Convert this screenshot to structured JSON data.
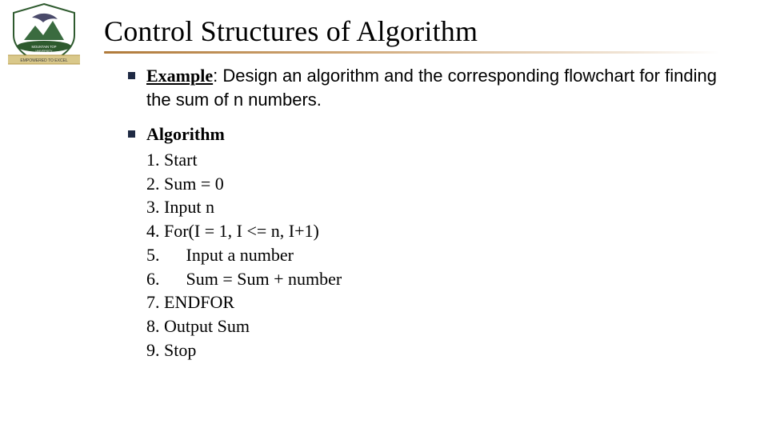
{
  "logo": {
    "alt": "Mountain Top University crest",
    "banner_text": "EMPOWERED TO EXCEL"
  },
  "title": "Control Structures of Algorithm",
  "example": {
    "label": "Example",
    "text": ": Design an algorithm and the corresponding flowchart for finding the sum of n numbers."
  },
  "algorithm": {
    "heading": "Algorithm",
    "steps": [
      "1. Start",
      "2. Sum = 0",
      "3. Input n",
      "4. For(I = 1, I <= n, I+1)",
      "5.      Input a number",
      "6.      Sum = Sum + number",
      "7. ENDFOR",
      "8. Output Sum",
      "9. Stop"
    ]
  }
}
